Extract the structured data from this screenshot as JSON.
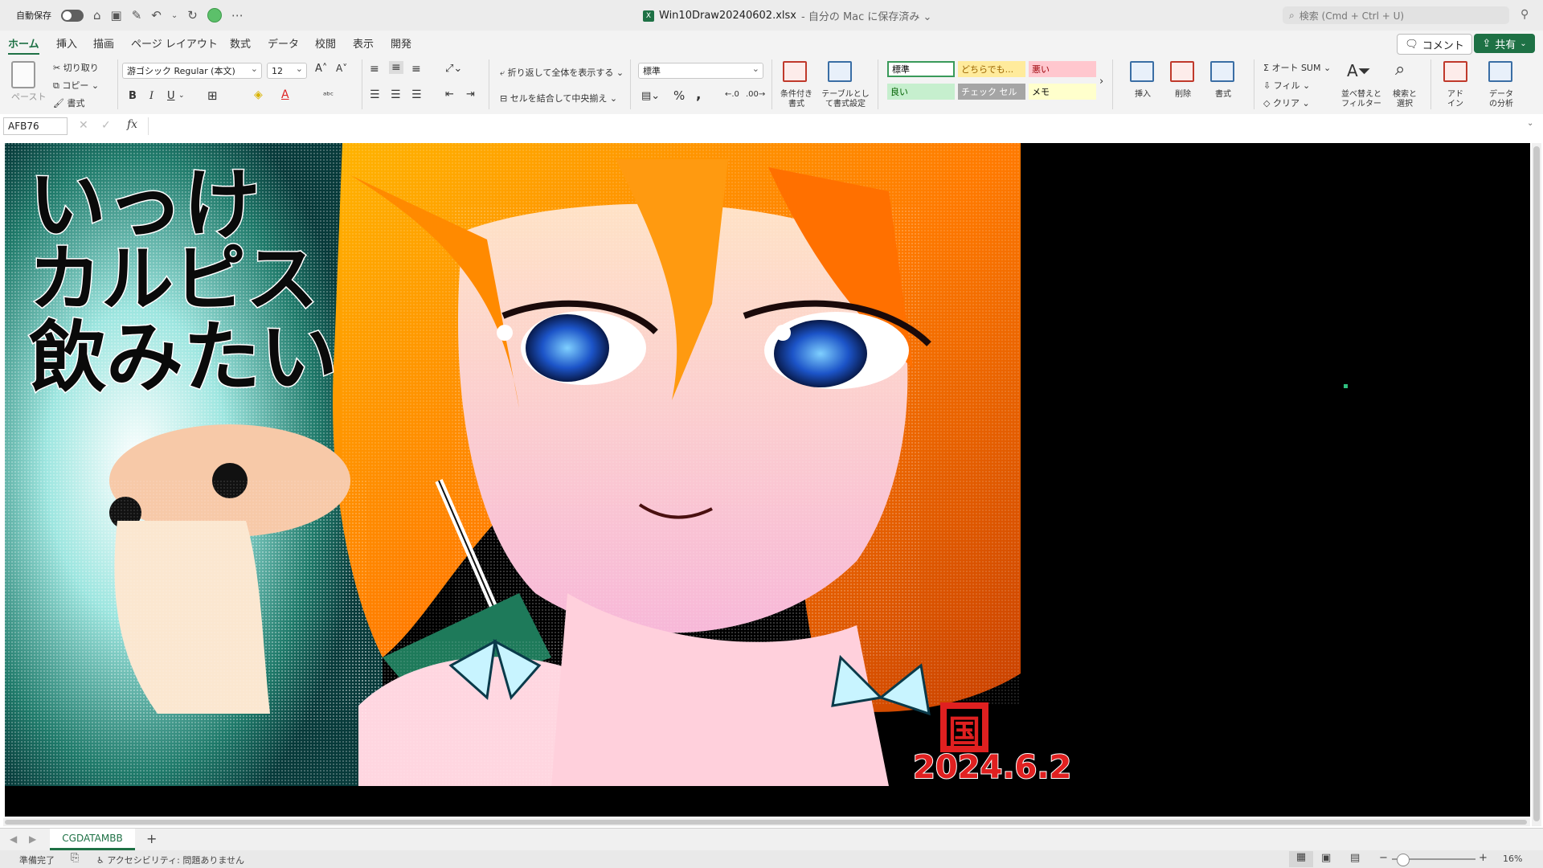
{
  "titlebar": {
    "autosave_label": "自動保存",
    "filename": "Win10Draw20240602.xlsx",
    "save_status": "- 自分の Mac に保存済み ⌄",
    "search_placeholder": "検索 (Cmd + Ctrl + U)"
  },
  "tabs": [
    "ホーム",
    "挿入",
    "描画",
    "ページ レイアウト",
    "数式",
    "データ",
    "校閲",
    "表示",
    "開発"
  ],
  "actions": {
    "comment": "コメント",
    "share": "共有"
  },
  "ribbon": {
    "clipboard": {
      "paste": "ペースト",
      "cut": "切り取り",
      "copy": "コピー",
      "format_painter": "書式"
    },
    "font": {
      "name": "游ゴシック Regular (本文)",
      "size": "12",
      "bold": "B",
      "italic": "I",
      "underline": "U"
    },
    "alignment": {
      "wrap": "折り返して全体を表示する",
      "merge": "セルを結合して中央揃え"
    },
    "number": {
      "format": "標準",
      "percent": "%",
      "comma": ","
    },
    "styles": {
      "conditional": "条件付き\n書式",
      "table": "テーブルとして書式設定",
      "cells": [
        {
          "label": "標準",
          "bg": "#ffffff",
          "fg": "#000000",
          "border": "#3a9a5a"
        },
        {
          "label": "どちらでも...",
          "bg": "#ffeb9c",
          "fg": "#9c6500"
        },
        {
          "label": "悪い",
          "bg": "#ffc7ce",
          "fg": "#9c0006"
        },
        {
          "label": "良い",
          "bg": "#c6efce",
          "fg": "#006100"
        },
        {
          "label": "チェック セル",
          "bg": "#a5a5a5",
          "fg": "#ffffff"
        },
        {
          "label": "メモ",
          "bg": "#ffffcc",
          "fg": "#000000"
        }
      ]
    },
    "cells_group": {
      "insert": "挿入",
      "delete": "削除",
      "format": "書式"
    },
    "editing": {
      "autosum": "オート SUM",
      "fill": "フィル",
      "clear": "クリア",
      "sort": "並べ替えと\nフィルター",
      "find": "検索と\n選択"
    },
    "addins": "アド\nイン",
    "analyze": "データ\nの分析"
  },
  "formula_bar": {
    "cell_ref": "AFB76",
    "fx": "fx",
    "value": ""
  },
  "artwork": {
    "title_text": "いっけ　カルピス　飲みたい",
    "signature": "国",
    "date": "2024.6.2"
  },
  "sheet_tabs": {
    "active": "CGDATAMBB",
    "add": "+"
  },
  "status": {
    "ready": "準備完了",
    "accessibility": "アクセシビリティ: 問題ありません",
    "zoom": "16%"
  }
}
